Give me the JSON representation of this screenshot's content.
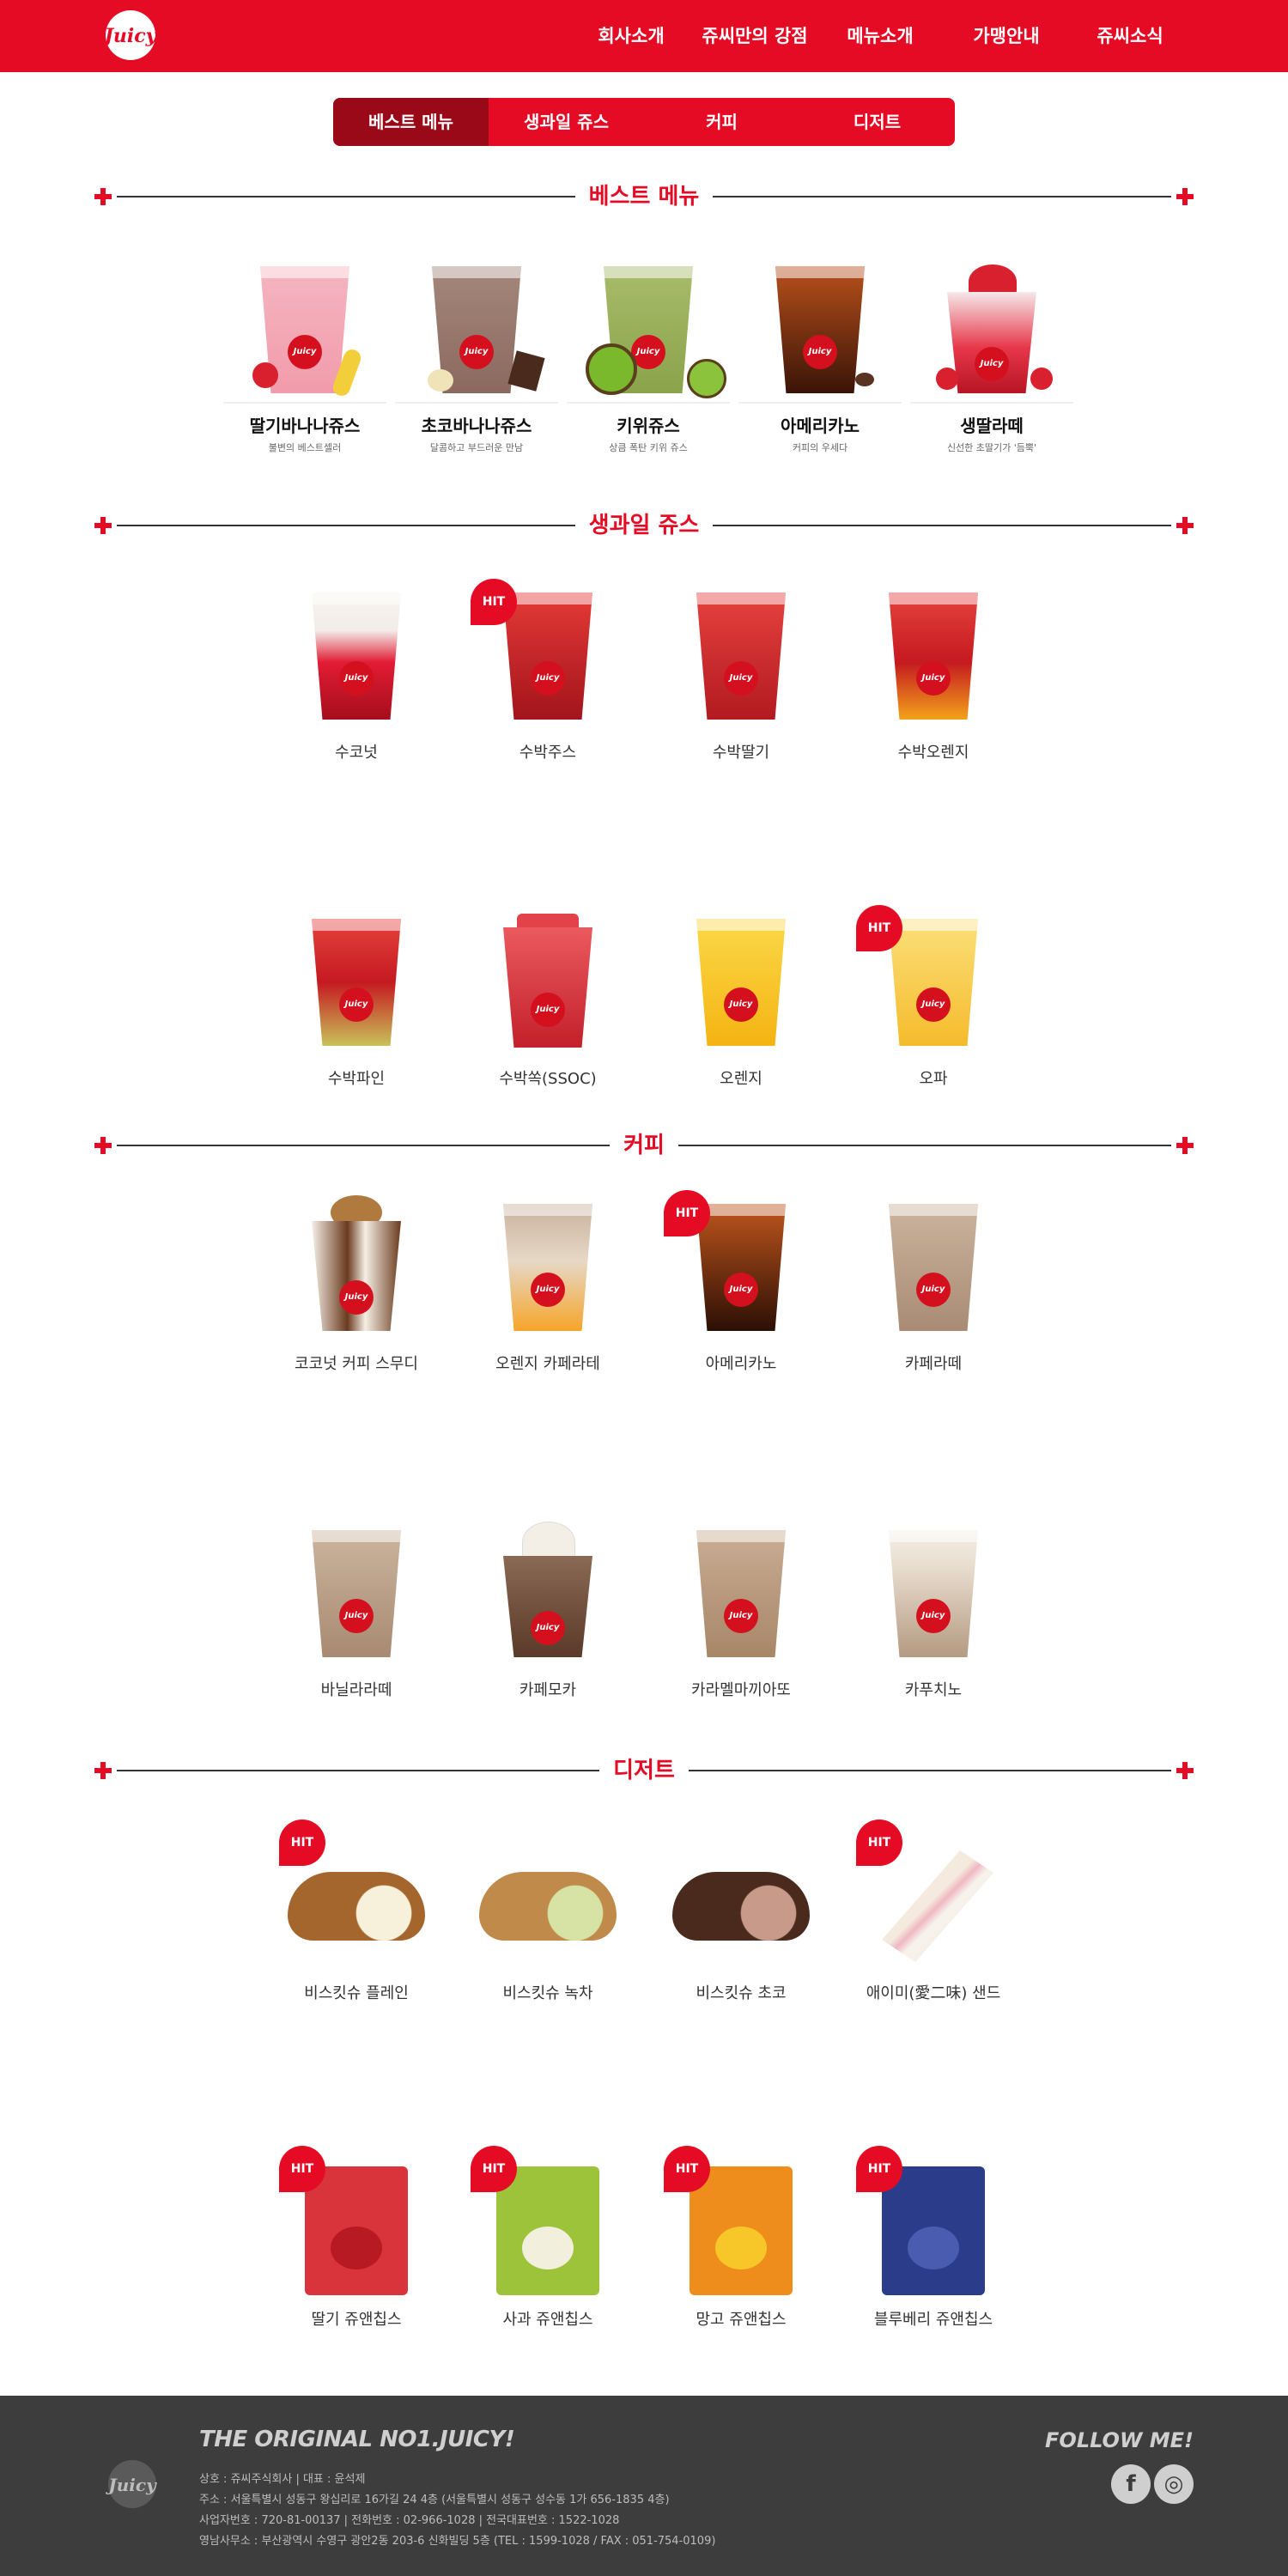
{
  "header": {
    "logo_text": "Juicy",
    "nav": [
      "회사소개",
      "쥬씨만의 강점",
      "메뉴소개",
      "가맹안내",
      "쥬씨소식"
    ]
  },
  "tabs": [
    "베스트 메뉴",
    "생과일 쥬스",
    "커피",
    "디저트"
  ],
  "sections": {
    "best": "베스트 메뉴",
    "juice": "생과일 쥬스",
    "coffee": "커피",
    "dessert": "디저트"
  },
  "best_menu": [
    {
      "name": "딸기바나나쥬스",
      "desc": "불변의 베스트셀러"
    },
    {
      "name": "초코바나나쥬스",
      "desc": "달콤하고 부드러운 만남"
    },
    {
      "name": "키위쥬스",
      "desc": "상큼 폭탄 키위 쥬스"
    },
    {
      "name": "아메리카노",
      "desc": "커피의 우세다"
    },
    {
      "name": "생딸라떼",
      "desc": "신선한 초딸기가 '듬뿍'"
    }
  ],
  "juices": [
    "수코넛",
    "수박주스",
    "수박딸기",
    "수박오렌지",
    "수박파인",
    "수박쏙(SSOC)",
    "오렌지",
    "오파"
  ],
  "coffees": [
    "코코넛 커피 스무디",
    "오렌지 카페라테",
    "아메리카노",
    "카페라떼",
    "바닐라라떼",
    "카페모카",
    "카라멜마끼아또",
    "카푸치노"
  ],
  "desserts": [
    "비스킷슈 플레인",
    "비스킷슈 녹차",
    "비스킷슈 초코",
    "애이미(愛二味) 샌드",
    "딸기 쥬앤칩스",
    "사과 쥬앤칩스",
    "망고 쥬앤칩스",
    "블루베리 쥬앤칩스"
  ],
  "hit_label": "HIT",
  "cup_logo": "Juicy",
  "footer": {
    "logo_text": "Juicy",
    "slogan": "THE ORIGINAL NO1.JUICY!",
    "company": "상호 : 쥬씨주식회사 | 대표 : 윤석제",
    "address": "주소 : 서울특별시 성동구 왕십리로 16가길 24 4층 (서울특별시 성동구 성수동 1가 656-1835 4층)",
    "biz": "사업자번호 : 720-81-00137 | 전화번호 : 02-966-1028 | 전국대표번호 : 1522-1028",
    "office": "영남사무소 : 부산광역시 수영구 광안2동 203-6 신화빌딩 5층 (TEL : 1599-1028 / FAX : 051-754-0109)",
    "follow": "FOLLOW ME!",
    "facebook_glyph": "f",
    "instagram_glyph": "◎"
  },
  "colors": {
    "brand_red": "#e60b24",
    "active_tab": "#9a0918",
    "footer_bg": "#3d3d3d"
  }
}
